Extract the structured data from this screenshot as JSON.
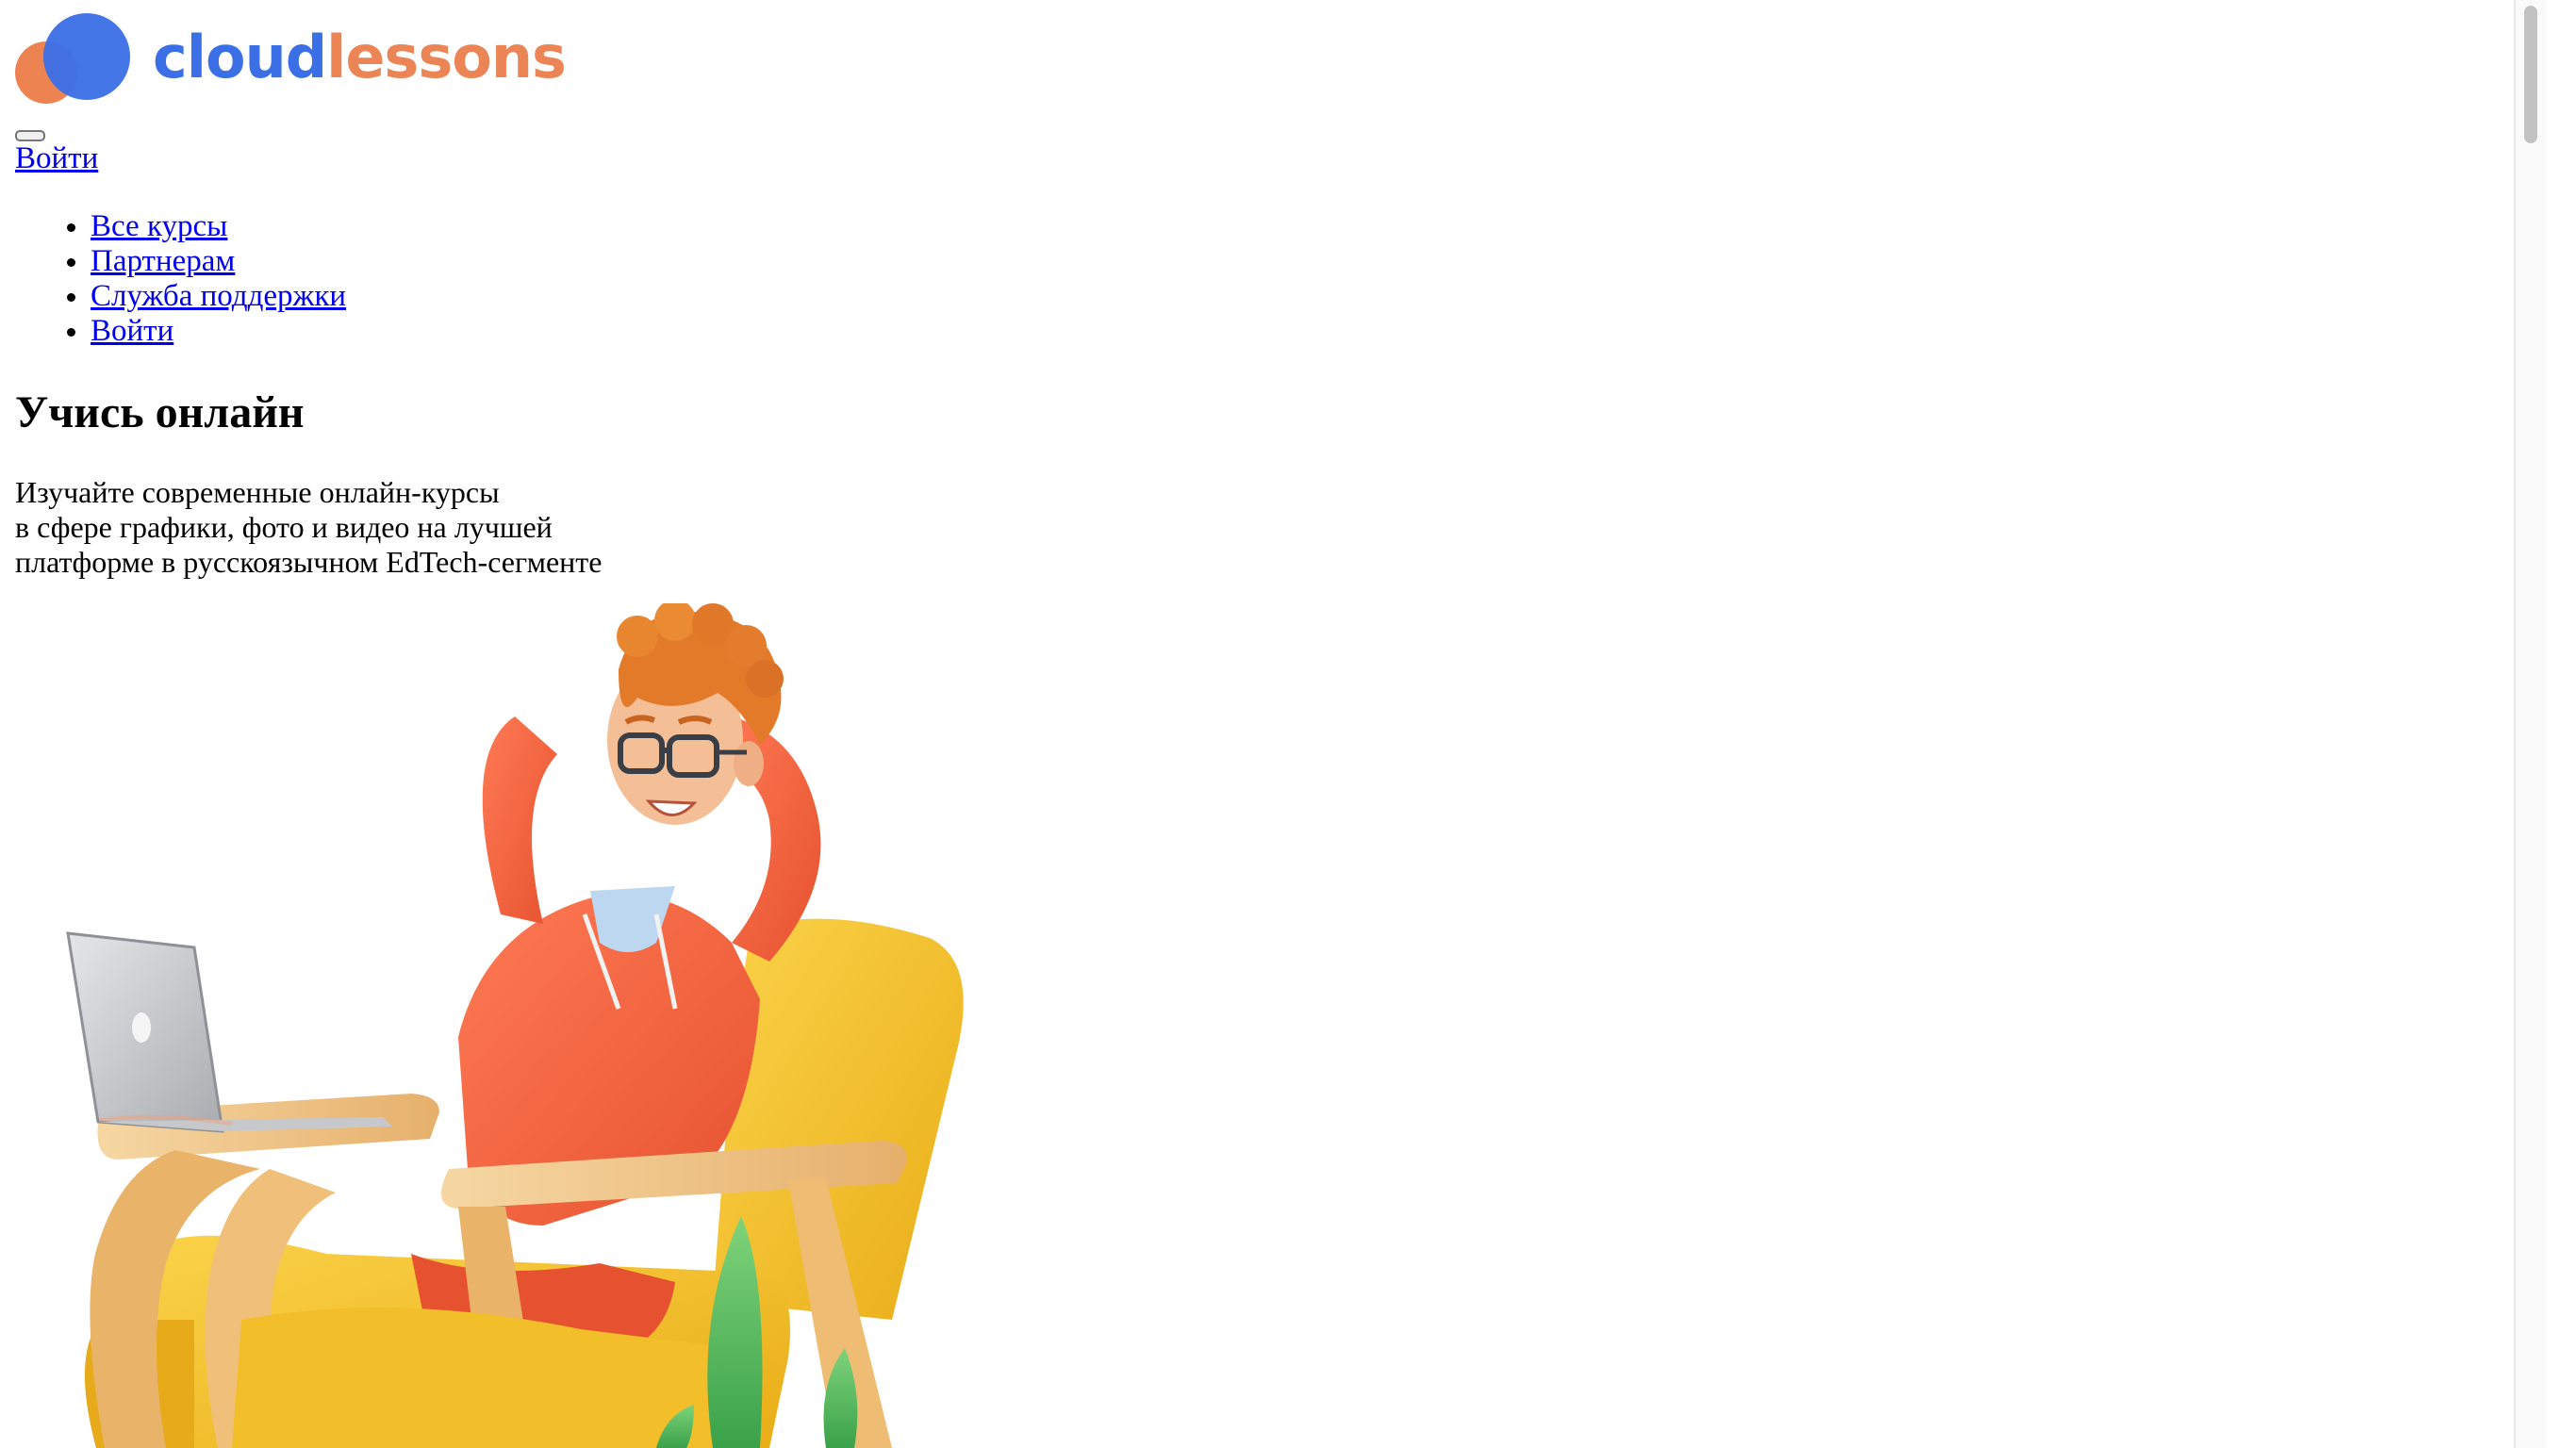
{
  "header": {
    "logo": {
      "part1": "cloud",
      "part2": "lessons",
      "color_primary": "#3b6fe6",
      "color_accent": "#ec8555"
    },
    "menu_toggle_icon": "menu-icon",
    "login_label": "Войти"
  },
  "nav": {
    "items": [
      {
        "label": "Все курсы"
      },
      {
        "label": "Партнерам"
      },
      {
        "label": "Служба поддержки"
      },
      {
        "label": "Войти"
      }
    ]
  },
  "hero": {
    "title": "Учись онлайн",
    "subtitle_lines": [
      "Изучайте современные онлайн-курсы",
      "в сфере графики, фото и видео на лучшей",
      "платформе в русскоязычном EdTech-сегменте"
    ],
    "illustration_icon": "student-relaxing-illustration"
  }
}
